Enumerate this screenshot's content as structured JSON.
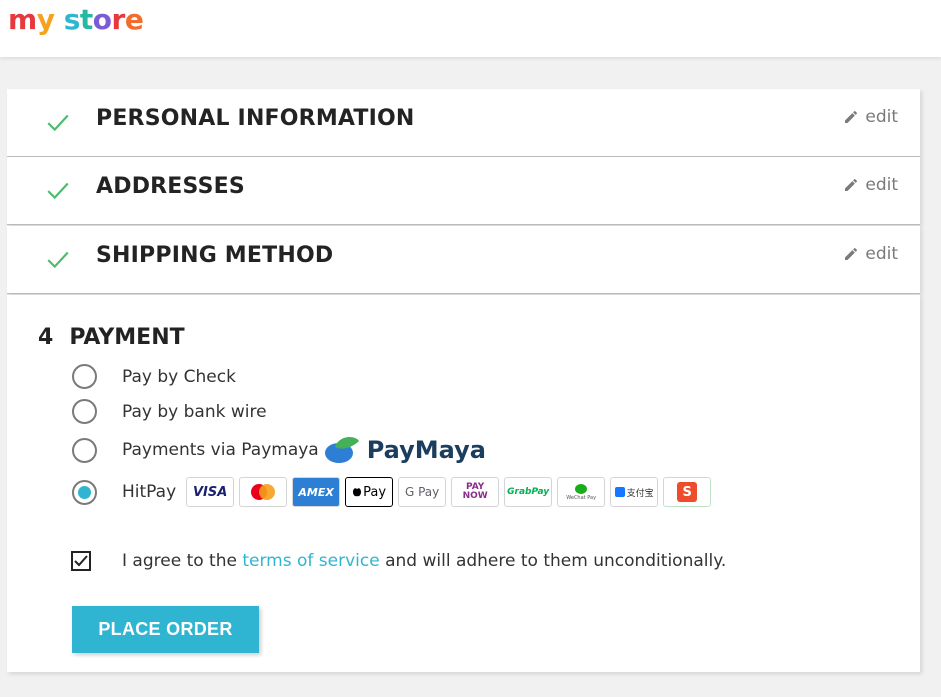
{
  "brand": {
    "logo": "my store"
  },
  "steps": [
    {
      "label": "PERSONAL INFORMATION",
      "edit": "edit"
    },
    {
      "label": "ADDRESSES",
      "edit": "edit"
    },
    {
      "label": "SHIPPING METHOD",
      "edit": "edit"
    }
  ],
  "payment": {
    "number": "4",
    "title": "PAYMENT",
    "options": [
      {
        "label": "Pay by Check",
        "selected": false
      },
      {
        "label": "Pay by bank wire",
        "selected": false
      },
      {
        "label": "Payments via Paymaya",
        "selected": false,
        "logo_text": "PayMaya"
      },
      {
        "label": "HitPay",
        "selected": true
      }
    ],
    "hitpay_methods": [
      "VISA",
      "mastercard-icon",
      "AMEX",
      "Pay",
      "G Pay",
      "PAY NOW",
      "GrabPay",
      "WeChat Pay",
      "支付宝",
      "S"
    ],
    "terms": {
      "checked": true,
      "before": "I agree to the ",
      "link": "terms of service",
      "after": " and will adhere to them unconditionally."
    },
    "place_order": "PLACE ORDER"
  },
  "colors": {
    "accent": "#2fb5d2",
    "check": "#4cbb6c"
  }
}
